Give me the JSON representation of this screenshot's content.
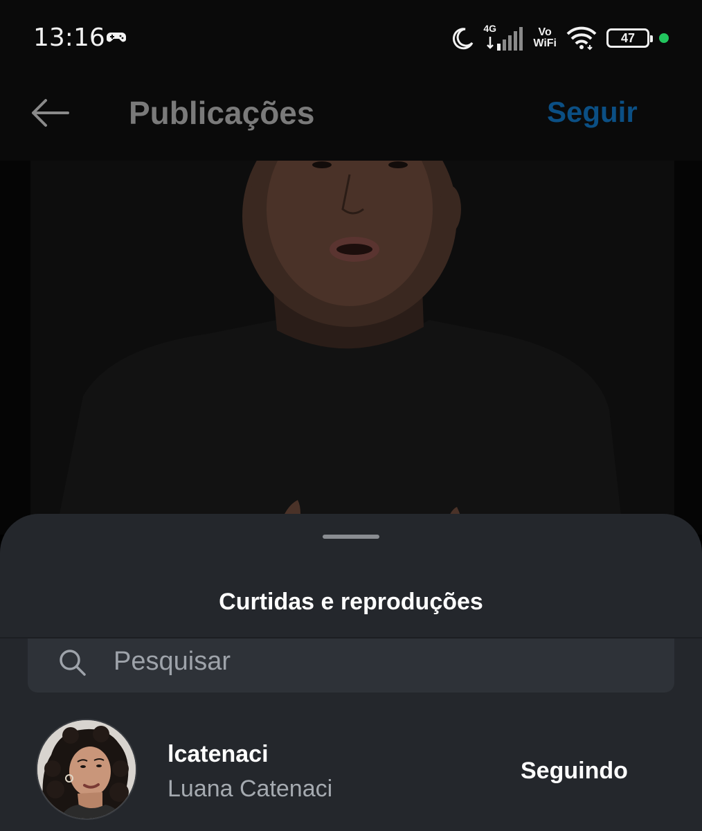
{
  "status_bar": {
    "time": "13:16",
    "network": "4G",
    "vowifi_top": "Vo",
    "vowifi_bottom": "WiFi",
    "battery": "47",
    "icons": [
      "gamepad-icon",
      "moon-icon",
      "signal-icon",
      "wifi-icon",
      "battery-icon"
    ]
  },
  "header": {
    "title": "Publicações",
    "follow_label": "Seguir"
  },
  "sheet": {
    "title": "Curtidas e reproduções",
    "search": {
      "placeholder": "Pesquisar"
    },
    "users": [
      {
        "username": "lcatenaci",
        "full_name": "Luana Catenaci",
        "action_label": "Seguindo"
      }
    ]
  },
  "colors": {
    "follow_link": "#0b4f84",
    "sheet_bg": "#24272c",
    "search_bg": "#2e3238",
    "online_dot": "#22c55e"
  }
}
